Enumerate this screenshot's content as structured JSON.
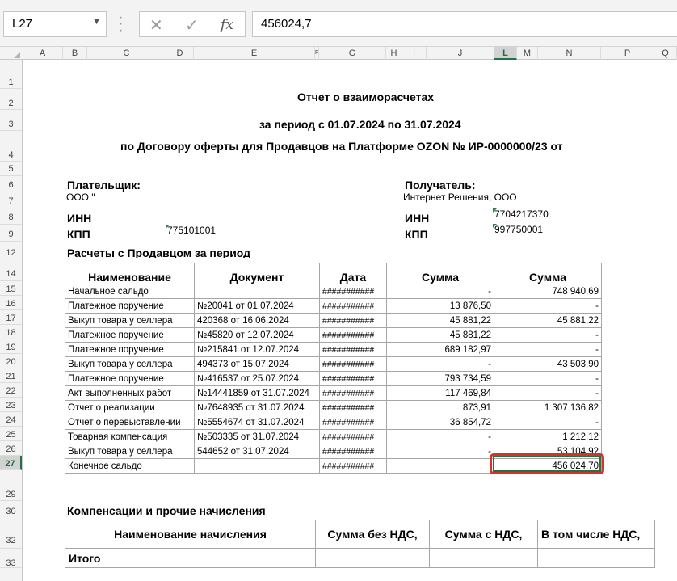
{
  "formula_bar": {
    "name_box": "L27",
    "cancel_icon": "✕",
    "enter_icon": "✓",
    "fx_label": "fx",
    "formula": "456024,7"
  },
  "columns": [
    "A",
    "B",
    "C",
    "D",
    "E",
    "F",
    "G",
    "H",
    "I",
    "J",
    "K",
    "L",
    "M",
    "N",
    "O",
    "P",
    "Q"
  ],
  "rows": [
    "1",
    "2",
    "3",
    "4",
    "5",
    "6",
    "7",
    "8",
    "9",
    "12",
    "14",
    "15",
    "16",
    "17",
    "18",
    "19",
    "20",
    "21",
    "22",
    "23",
    "24",
    "25",
    "26",
    "27",
    "29",
    "30",
    "32",
    "33"
  ],
  "selected": {
    "column": "L",
    "row": "27"
  },
  "report": {
    "title": "Отчет о взаиморасчетах",
    "period": "за период с  01.07.2024 по 31.07.2024",
    "contract": "по Договору оферты для Продавцов на Платформе OZON № ИР-0000000/23  от"
  },
  "payer": {
    "label": "Плательщик:",
    "name": "ООО \"",
    "inn_label": "ИНН",
    "kpp_label": "КПП",
    "kpp": "775101001"
  },
  "recipient": {
    "label": "Получатель:",
    "name": "Интернет Решения, ООО",
    "inn_label": "ИНН",
    "inn": "7704217370",
    "kpp_label": "КПП",
    "kpp": "997750001"
  },
  "section_title": "Расчеты с Продавцом за период",
  "table": {
    "headers": [
      "Наименование",
      "Документ",
      "Дата",
      "Сумма",
      "Сумма"
    ],
    "rows": [
      [
        "Начальное сальдо",
        "",
        "###########",
        "-",
        "748 940,69"
      ],
      [
        "Платежное поручение",
        "№20041 от 01.07.2024",
        "###########",
        "13 876,50",
        "-"
      ],
      [
        "Выкуп товара у селлера",
        "420368 от 16.06.2024",
        "###########",
        "45 881,22",
        "45 881,22"
      ],
      [
        "Платежное поручение",
        "№45820 от 12.07.2024",
        "###########",
        "45 881,22",
        "-"
      ],
      [
        "Платежное поручение",
        "№215841 от 12.07.2024",
        "###########",
        "689 182,97",
        "-"
      ],
      [
        "Выкуп товара у селлера",
        "494373 от 15.07.2024",
        "###########",
        "-",
        "43 503,90"
      ],
      [
        "Платежное поручение",
        "№416537 от 25.07.2024",
        "###########",
        "793 734,59",
        "-"
      ],
      [
        "Акт выполненных работ",
        "№14441859 от 31.07.2024",
        "###########",
        "117 469,84",
        "-"
      ],
      [
        "Отчет о реализации",
        "№7648935 от 31.07.2024",
        "###########",
        "873,91",
        "1 307 136,82"
      ],
      [
        "Отчет о перевыставлении",
        "№5554674 от 31.07.2024",
        "###########",
        "36 854,72",
        "-"
      ],
      [
        "Товарная компенсация",
        "№503335 от 31.07.2024",
        "###########",
        "-",
        "1 212,12"
      ],
      [
        "Выкуп товара у селлера",
        "544652 от 31.07.2024",
        "###########",
        "-",
        "53 104,92"
      ],
      [
        "Конечное сальдо",
        "",
        "###########",
        "",
        "456 024,70"
      ]
    ]
  },
  "compensation": {
    "title": "Компенсации и прочие начисления",
    "headers": [
      "Наименование начисления",
      "Сумма без НДС,",
      "Сумма с НДС,",
      "В том числе НДС,"
    ],
    "total_label": "Итого"
  }
}
